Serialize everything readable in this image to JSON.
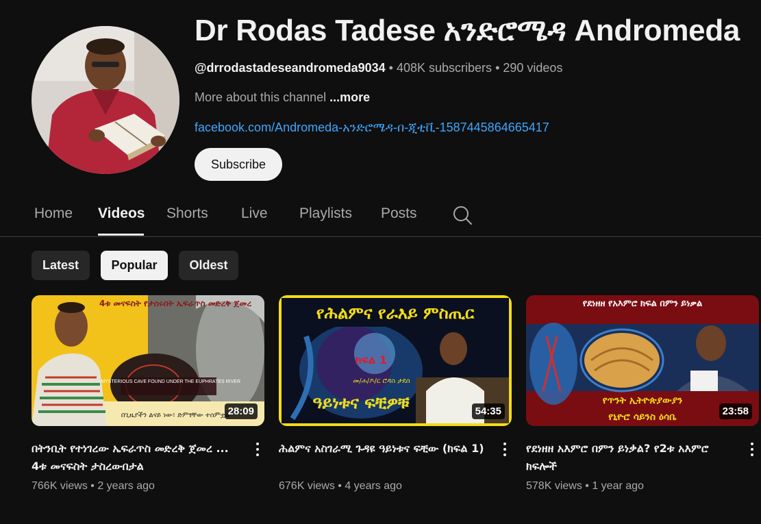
{
  "channel": {
    "name": "Dr Rodas Tadese አንድሮሜዳ Andromeda",
    "handle": "@drrodastadeseandromeda9034",
    "subscribers": "408K subscribers",
    "videos_count": "290 videos",
    "separator": " • ",
    "about": "More about this channel",
    "more": "...more",
    "link": "facebook.com/Andromeda-አንድሮሜዳ-በ-ጂቲቪ-1587445864665417",
    "subscribe_label": "Subscribe"
  },
  "tabs": [
    {
      "label": "Home"
    },
    {
      "label": "Videos"
    },
    {
      "label": "Shorts"
    },
    {
      "label": "Live"
    },
    {
      "label": "Playlists"
    },
    {
      "label": "Posts"
    }
  ],
  "filters": [
    {
      "label": "Latest"
    },
    {
      "label": "Popular"
    },
    {
      "label": "Oldest"
    }
  ],
  "videos": [
    {
      "title": "በትንቢት የተነገረው ኤፍራጥስ መድረቅ ጀመረ ... 4ቱ መናፍስት ታስረውበታል",
      "views": "766K views",
      "age": "2 years ago",
      "duration": "28:09",
      "thumb_text_top": "4ቱ መናፍስት የታሰሩበት ኤፍራጥስ መድረቅ ጀመረ",
      "thumb_text_cave": "A MYSTERIOUS CAVE FOUND UNDER THE EUPHRATES RIVER",
      "thumb_text_bottom": "በጊዜያችን ልናይ ነው፣ ድምፃቸው ተሰምቷል"
    },
    {
      "title": "ሕልምና አስገራሚ ጉዳዩ ዓይነቱና ፍቺው (ክፍል 1)",
      "views": "676K views",
      "age": "4 years ago",
      "duration": "54:35",
      "thumb_text_top": "የሕልምና የራእይ ምስጢር",
      "thumb_text_part": "ክፍል 1",
      "thumb_text_author": "መ/ሐ/ዶ/ር ሮዳስ ታደሰ",
      "thumb_text_bottom": "ዓይነቱና ፍቺዎቹ"
    },
    {
      "title": "የደነዘዘ አእምሮ በምን ይነቃል? የ2ቱ አእምሮ ክፍሎች",
      "views": "578K views",
      "age": "1 year ago",
      "duration": "23:58",
      "thumb_text_top": "የደነዘዘ የአእምሮ ክፍል በምን ይነቃል",
      "thumb_text_bottom_1": "የጥንት ኢትዮጵያውያን",
      "thumb_text_bottom_2": "የኒዮሮ ሳይንስ ዕሳቤ"
    }
  ],
  "colors": {
    "background": "#0f0f0f",
    "link": "#3ea6ff",
    "muted": "#aaaaaa",
    "chip": "#272727"
  }
}
